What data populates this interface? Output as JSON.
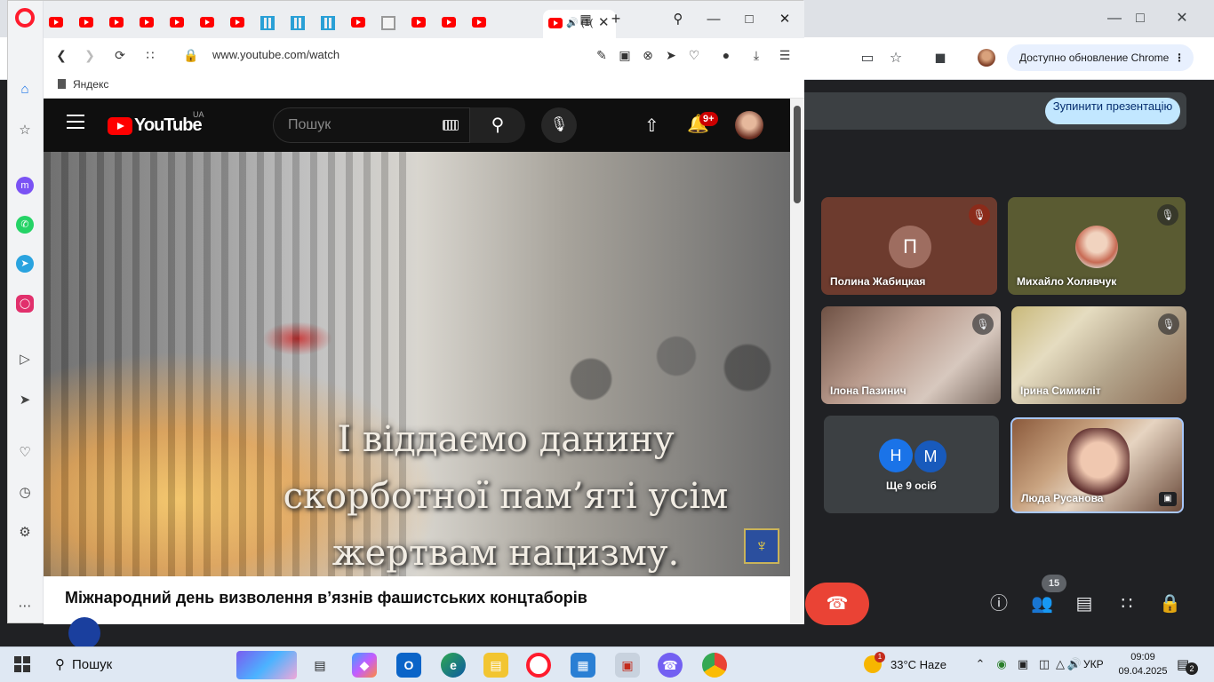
{
  "opera": {
    "url": "www.youtube.com/watch",
    "bookmark": "Яндекс",
    "active_tab_title": "(1("
  },
  "youtube": {
    "logo_text": "YouTube",
    "region": "UA",
    "search_placeholder": "Пошук",
    "notification_count": "9+",
    "video_caption_lines": [
      "І віддаємо данину",
      "скорботної пам’яті усім",
      "жертвам нацизму."
    ],
    "video_title": "Міжнародний день визволення в’язнів фашистських концтаборів"
  },
  "chrome": {
    "update_button": "Доступно обновление Chrome"
  },
  "meet": {
    "stop_presenting": "Зупинити презентацію",
    "participants": [
      {
        "name": "Полина Жабицкая",
        "initial": "П",
        "muted": true
      },
      {
        "name": "Михайло Холявчук",
        "muted": true
      },
      {
        "name": "Ілона Пазинич",
        "muted": true
      },
      {
        "name": "Ірина Симикліт",
        "muted": true
      },
      {
        "name": "Люда Русанова",
        "muted": false
      }
    ],
    "more": {
      "label": "Ще 9 осіб",
      "initials": [
        "Н",
        "М"
      ]
    },
    "people_count": "15"
  },
  "taskbar": {
    "search_label": "Пошук",
    "weather": "33°C  Haze",
    "weather_badge": "1",
    "language": "УКР",
    "time": "09:09",
    "date": "09.04.2025",
    "notifications": "2"
  },
  "icons": {
    "meet": [
      "info-icon",
      "people-icon",
      "chat-icon",
      "apps-icon",
      "host-controls-icon"
    ],
    "accent": "#1a73e8",
    "end_call": "#ea4335"
  }
}
